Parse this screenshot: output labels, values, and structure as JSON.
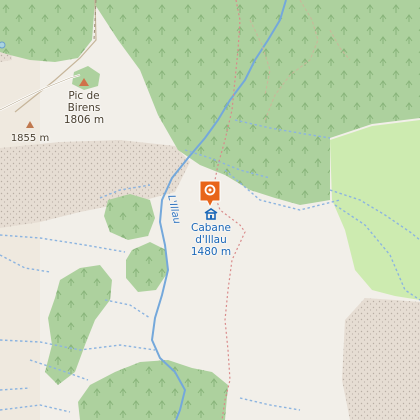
{
  "map": {
    "colors": {
      "background": "#f2efe9",
      "forest": "#add19e",
      "forest_dark": "#9ec891",
      "meadow": "#cdebb0",
      "scree": "#e6ddd3",
      "water": "#8cb4e0",
      "river": "#74a8db",
      "trail": "#d98a8a",
      "track": "#c9b89a",
      "marker": "#e8651a",
      "hut": "#1a67b8"
    },
    "peak": {
      "name": "Pic de",
      "name2": "Birens",
      "elevation": "1806 m"
    },
    "spot": {
      "elevation": "1855 m"
    },
    "hut": {
      "name": "Cabane",
      "name2": "d'Illau",
      "elevation": "1480 m"
    },
    "river": {
      "name": "L'Illau"
    },
    "icons": {
      "marker": "map-pin-icon",
      "hut": "shelter-icon",
      "peak": "peak-triangle-icon",
      "spot": "elevation-point-icon"
    }
  }
}
